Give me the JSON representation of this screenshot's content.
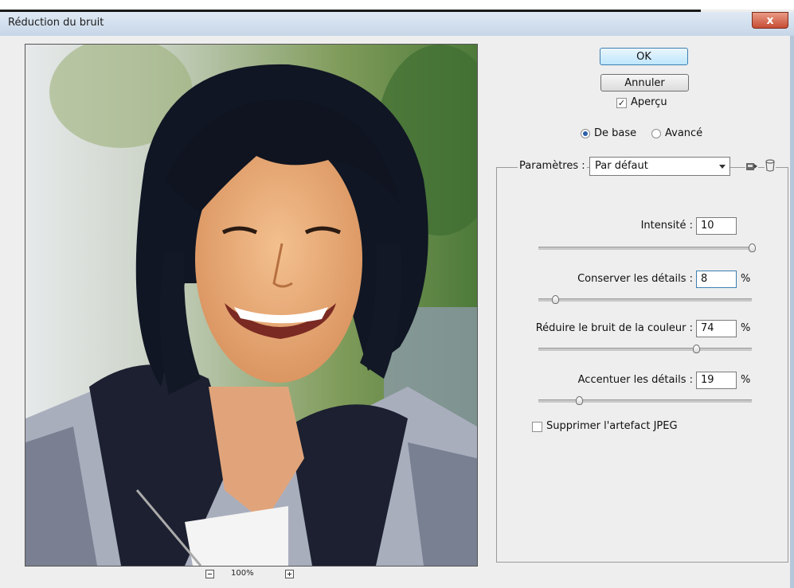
{
  "dialog": {
    "title": "Réduction du bruit",
    "close_label": "x"
  },
  "buttons": {
    "ok": "OK",
    "cancel": "Annuler"
  },
  "preview_option": {
    "label": "Aperçu",
    "checked": true
  },
  "mode": {
    "options": [
      "De base",
      "Avancé"
    ],
    "selected": "De base"
  },
  "settings": {
    "label": "Paramètres :",
    "selected": "Par défaut"
  },
  "controls": [
    {
      "label": "Intensité :",
      "value": "10",
      "unit": "",
      "level": 1.0
    },
    {
      "label": "Conserver les détails :",
      "value": "8",
      "unit": "%",
      "level": 0.08
    },
    {
      "label": "Réduire le bruit de la couleur :",
      "value": "74",
      "unit": "%",
      "level": 0.74
    },
    {
      "label": "Accentuer les détails :",
      "value": "19",
      "unit": "%",
      "level": 0.19
    }
  ],
  "jpeg_option": {
    "label": "Supprimer l'artefact JPEG",
    "checked": false
  },
  "zoom": {
    "level": "100%"
  },
  "colors": {
    "titlebar": "#c7d6e8",
    "close": "#c74d34",
    "ok_border": "#3c7fb1"
  }
}
